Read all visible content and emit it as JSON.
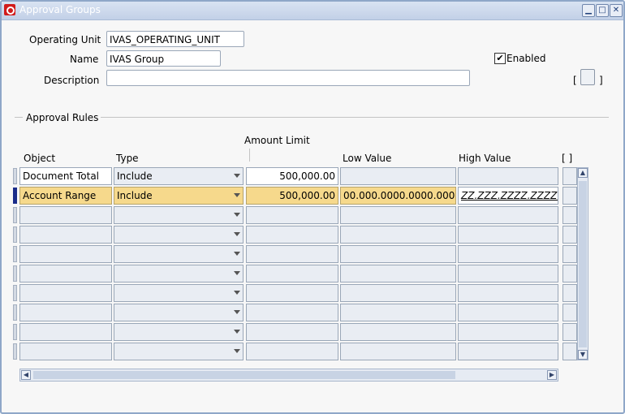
{
  "window": {
    "title": "Approval Groups"
  },
  "form": {
    "operating_unit_label": "Operating Unit",
    "operating_unit_value": "IVAS_OPERATING_UNIT",
    "name_label": "Name",
    "name_value": "IVAS Group",
    "description_label": "Description",
    "description_value": "",
    "enabled_label": "Enabled",
    "enabled_check": "✔",
    "flex_open": "[",
    "flex_close": "]"
  },
  "section": {
    "title": "Approval Rules"
  },
  "table": {
    "headers": {
      "object": "Object",
      "type": "Type",
      "amount_limit": "Amount Limit",
      "low_value": "Low Value",
      "high_value": "High Value",
      "flex": "[ ]"
    },
    "rows": [
      {
        "object": "Document Total",
        "type": "Include",
        "amount": "500,000.00",
        "low": "",
        "high": ""
      },
      {
        "object": "Account Range",
        "type": "Include",
        "amount": "500,000.00",
        "low": "00.000.0000.0000.0000",
        "high": "ZZ.ZZZ.ZZZZ.ZZZZ.ZZ"
      }
    ]
  }
}
